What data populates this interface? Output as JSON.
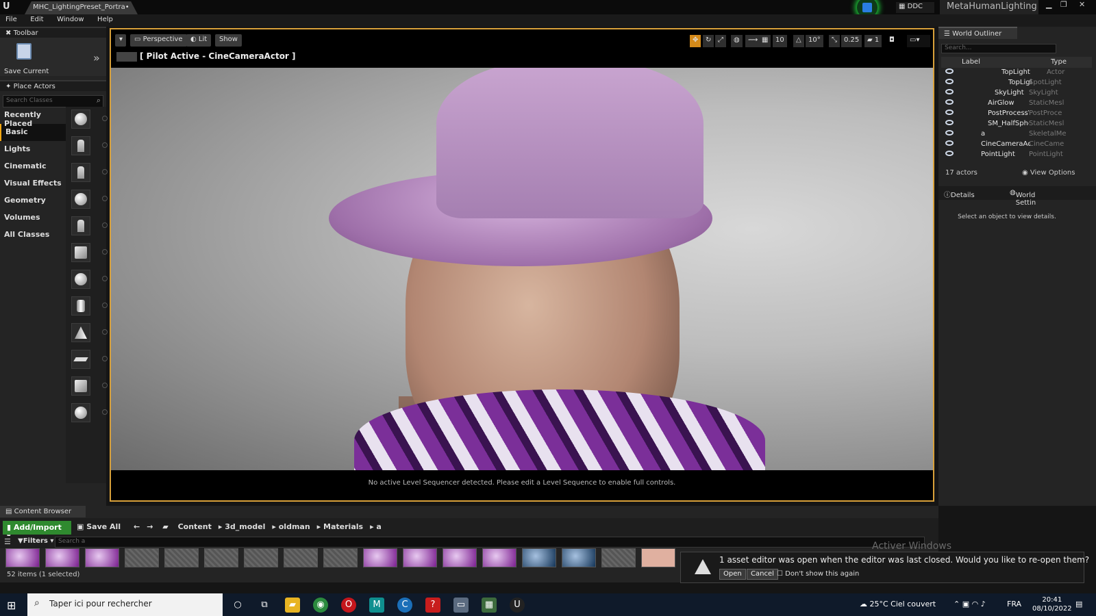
{
  "window": {
    "tab_title": "MHC_LightingPreset_Portra•",
    "ddc_label": "DDC",
    "project_name": "MetaHumanLighting",
    "minimize": "▁",
    "maximize": "❐",
    "close": "✕"
  },
  "menu": [
    "File",
    "Edit",
    "Window",
    "Help"
  ],
  "toolbar_panel": {
    "tab": "Toolbar",
    "save_current": "Save Current"
  },
  "place_actors": {
    "tab": "Place Actors",
    "search_placeholder": "Search Classes",
    "categories": [
      "Recently Placed",
      "Basic",
      "Lights",
      "Cinematic",
      "Visual Effects",
      "Geometry",
      "Volumes",
      "All Classes"
    ],
    "selected_category": "Basic"
  },
  "viewport": {
    "perspective": "Perspective",
    "lit": "Lit",
    "show": "Show",
    "pilot": "[ Pilot Active - CineCameraActor ]",
    "grid_snap": "10",
    "rotation_snap": "10°",
    "scale_snap": "0.25",
    "camera_speed": "1",
    "sequencer_msg": "No active Level Sequencer detected. Please edit a Level Sequence to enable full controls."
  },
  "outliner": {
    "tab": "World Outliner",
    "search_placeholder": "Search...",
    "col_label": "Label",
    "col_type": "Type",
    "rows": [
      {
        "name": "TopLight",
        "type": "Actor"
      },
      {
        "name": "TopLigl",
        "type": "SpotLight"
      },
      {
        "name": "SkyLight",
        "type": "SkyLight"
      },
      {
        "name": "AirGlow",
        "type": "StaticMesl"
      },
      {
        "name": "PostProcessV",
        "type": "PostProce"
      },
      {
        "name": "SM_HalfSpher",
        "type": "StaticMesl"
      },
      {
        "name": "a",
        "type": "SkeletalMe"
      },
      {
        "name": "CineCameraActc",
        "type": "CineCame"
      },
      {
        "name": "PointLight",
        "type": "PointLight"
      }
    ],
    "actor_count": "17 actors",
    "view_options": "View Options"
  },
  "details": {
    "tab_details": "Details",
    "tab_world": "World Settin",
    "empty_msg": "Select an object to view details."
  },
  "content_browser": {
    "tab": "Content Browser",
    "add_import": "Add/Import",
    "save_all": "Save All",
    "path": [
      "Content",
      "3d_model",
      "oldman",
      "Materials",
      "a"
    ],
    "filters": "Filters",
    "search_placeholder": "Search a",
    "items_status": "52 items (1 selected)"
  },
  "notification": {
    "message": "1 asset editor was open when the editor was last closed. Would you like to re-open them?",
    "open": "Open",
    "cancel": "Cancel",
    "dont_show": "Don't show this again"
  },
  "watermark": "Activer Windows",
  "taskbar": {
    "search_placeholder": "Taper ici pour rechercher",
    "weather": "25°C Ciel couvert",
    "lang": "FRA",
    "time": "20:41",
    "date": "08/10/2022"
  }
}
